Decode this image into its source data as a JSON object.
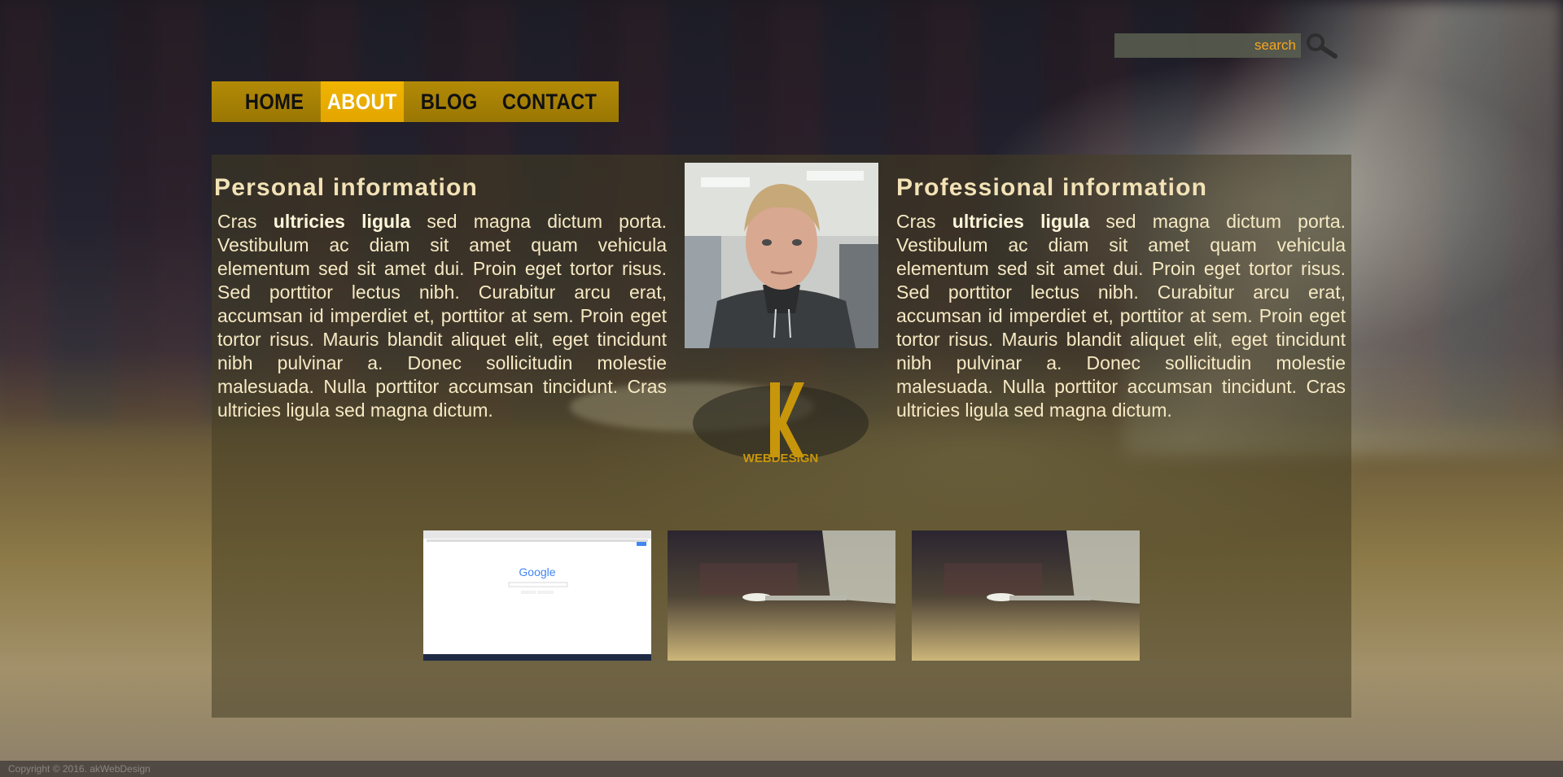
{
  "search": {
    "placeholder": "search"
  },
  "nav": {
    "items": [
      "HOME",
      "ABOUT",
      "BLOG",
      "CONTACT"
    ],
    "active": "ABOUT"
  },
  "personal": {
    "heading": "Personal information",
    "lead_normal": "Cras ",
    "lead_bold": "ultricies ligula",
    "body": " sed magna dictum porta. Vestibulum ac diam sit amet quam vehicula elementum sed sit amet dui. Proin eget tortor risus. Sed porttitor lectus nibh. Curabitur arcu erat, accumsan id imperdiet et, porttitor at sem. Proin eget tortor risus. Mauris blandit aliquet elit, eget tincidunt nibh pulvinar a. Donec sollicitudin molestie malesuada. Nulla porttitor accumsan tincidunt. Cras ultricies ligula sed magna dictum."
  },
  "professional": {
    "heading": "Professional information",
    "lead_normal": "Cras ",
    "lead_bold": "ultricies ligula",
    "body": " sed magna dictum porta. Vestibulum ac diam sit amet quam vehicula elementum sed sit amet dui. Proin eget tortor risus. Sed porttitor lectus nibh. Curabitur arcu erat, accumsan id imperdiet et, porttitor at sem. Proin eget tortor risus. Mauris blandit aliquet elit, eget tincidunt nibh pulvinar a. Donec sollicitudin molestie malesuada. Nulla porttitor accumsan tincidunt. Cras ultricies ligula sed magna dictum."
  },
  "logo": {
    "text": "WEBDESIGN",
    "letter": "K"
  },
  "thumbnails": {
    "google_text": "Google"
  },
  "footer": {
    "copyright": "Copyright © 2016. akWebDesign"
  },
  "colors": {
    "accent": "#f0b400",
    "nav_bg": "#a98205",
    "search_text": "#f5a623"
  }
}
